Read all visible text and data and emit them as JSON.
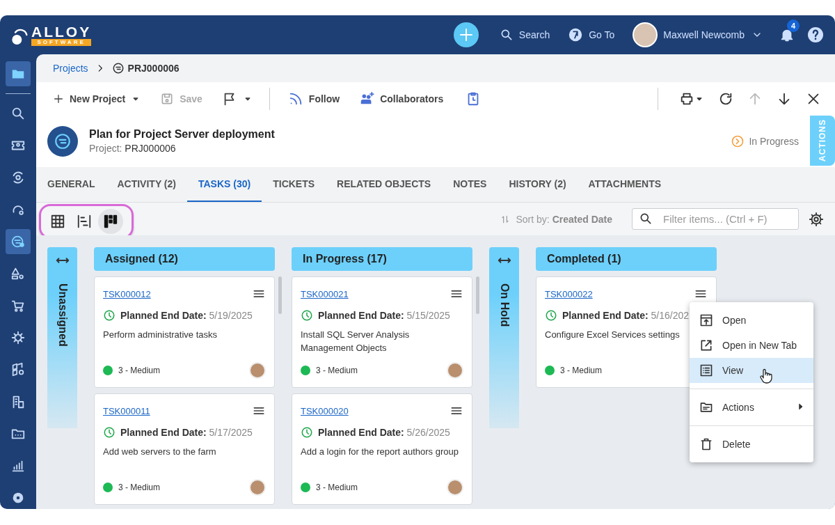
{
  "logo": {
    "name": "ALLOY",
    "tagline": "SOFTWARE"
  },
  "top_bar": {
    "search": "Search",
    "go_to": "Go To",
    "user_name": "Maxwell Newcomb",
    "notification_count": "4"
  },
  "sidebar": {
    "items": [
      {
        "selected": true
      },
      {
        "selected": false
      },
      {
        "selected": false
      },
      {
        "selected": false
      },
      {
        "selected": false
      },
      {
        "selected": true
      },
      {
        "selected": false
      },
      {
        "selected": false
      },
      {
        "selected": false
      },
      {
        "selected": false
      },
      {
        "selected": false
      },
      {
        "selected": false
      },
      {
        "selected": false
      },
      {
        "selected": false
      }
    ]
  },
  "breadcrumb": {
    "parent": "Projects",
    "current": "PRJ000006"
  },
  "toolbar": {
    "new_project": "New Project",
    "save": {
      "label": "Save",
      "disabled": true
    },
    "follow": "Follow",
    "collaborators": "Collaborators",
    "nav_buttons": [
      {
        "disabled": false
      },
      {
        "disabled": false
      },
      {
        "disabled": true
      },
      {
        "disabled": false
      },
      {
        "disabled": false
      }
    ]
  },
  "header": {
    "title": "Plan for Project Server deployment",
    "subtitle_label": "Project:",
    "subtitle_value": "PRJ000006",
    "status": "In Progress",
    "actions_tab": "ACTIONS"
  },
  "tabs": [
    {
      "label": "GENERAL",
      "selected": false
    },
    {
      "label": "ACTIVITY (2)",
      "selected": false
    },
    {
      "label": "TASKS (30)",
      "selected": true
    },
    {
      "label": "TICKETS",
      "selected": false
    },
    {
      "label": "RELATED OBJECTS",
      "selected": false
    },
    {
      "label": "NOTES",
      "selected": false
    },
    {
      "label": "HISTORY (2)",
      "selected": false
    },
    {
      "label": "ATTACHMENTS",
      "selected": false
    }
  ],
  "view_switcher": [
    {
      "selected": false
    },
    {
      "selected": false
    },
    {
      "selected": true
    }
  ],
  "sort": "Sort by: **Created Date**",
  "filter": {
    "placeholder": "Filter items... (Ctrl + F)"
  },
  "columns": [
    {
      "title": "Unassigned",
      "collapsed": true
    },
    {
      "title": "Assigned (12)",
      "collapsed": false,
      "scrollbar": true,
      "cards": [
        {
          "id": "TSK000012",
          "date_label": "Planned End Date:",
          "date": "5/19/2025",
          "description": "Perform administrative tasks",
          "priority": "3 - Medium",
          "color": "#1db954",
          "assignee_photo": true
        },
        {
          "id": "TSK000011",
          "date_label": "Planned End Date:",
          "date": "5/17/2025",
          "description": "Add web servers to the farm",
          "priority": "3 - Medium",
          "color": "#1db954",
          "assignee_photo": true
        }
      ]
    },
    {
      "title": "In Progress (17)",
      "collapsed": false,
      "scrollbar": true,
      "cards": [
        {
          "id": "TSK000021",
          "date_label": "Planned End Date:",
          "date": "5/15/2025",
          "description": "Install SQL Server Analysis Management Objects",
          "priority": "3 - Medium",
          "color": "#1db954",
          "assignee_photo": true
        },
        {
          "id": "TSK000020",
          "date_label": "Planned End Date:",
          "date": "5/26/2025",
          "description": "Add a login for the report authors group",
          "priority": "3 - Medium",
          "color": "#1db954",
          "assignee_photo": true
        }
      ]
    },
    {
      "title": "On Hold",
      "collapsed": true
    },
    {
      "title": "Completed (1)",
      "collapsed": false,
      "scrollbar": false,
      "cards": [
        {
          "id": "TSK000022",
          "date_label": "Planned End Date:",
          "date": "5/16/202",
          "description": "Configure Excel Services settings",
          "priority": "3 - Medium",
          "color": "#1db954"
        }
      ]
    }
  ],
  "context_menu": [
    {
      "kind": "item",
      "label": "Open",
      "selected": false
    },
    {
      "kind": "item",
      "label": "Open in New Tab",
      "selected": false
    },
    {
      "kind": "item",
      "label": "View",
      "selected": true
    },
    {
      "kind": "divider"
    },
    {
      "kind": "submenu",
      "label": "Actions",
      "selected": false
    },
    {
      "kind": "divider"
    },
    {
      "kind": "item",
      "label": "Delete",
      "selected": false
    }
  ]
}
